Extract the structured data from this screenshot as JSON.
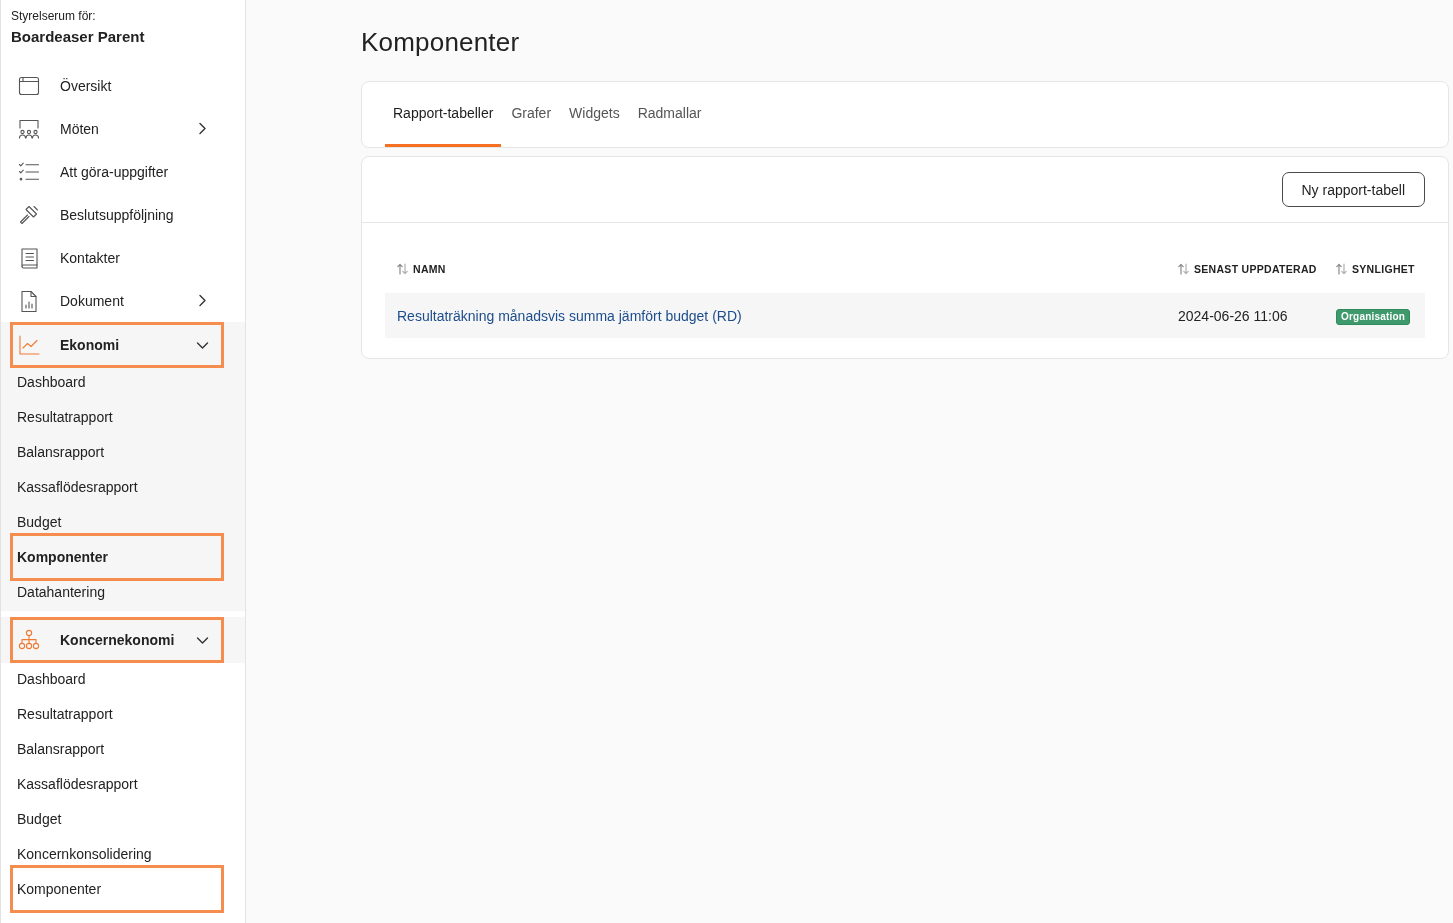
{
  "sidebar": {
    "caption": "Styrelserum för:",
    "org_name": "Boardeaser Parent",
    "items": [
      {
        "kind": "link",
        "label": "Översikt",
        "highlighted": false
      },
      {
        "kind": "group",
        "label": "Möten",
        "expanded": false,
        "highlighted": false
      },
      {
        "kind": "link",
        "label": "Att göra-uppgifter",
        "highlighted": false
      },
      {
        "kind": "link",
        "label": "Beslutsuppföljning",
        "highlighted": false
      },
      {
        "kind": "link",
        "label": "Kontakter",
        "highlighted": false
      },
      {
        "kind": "group",
        "label": "Dokument",
        "expanded": false,
        "highlighted": false
      },
      {
        "kind": "group",
        "label": "Ekonomi",
        "expanded": true,
        "highlighted": true,
        "children": [
          {
            "label": "Dashboard",
            "selected": false,
            "highlighted": false
          },
          {
            "label": "Resultatrapport",
            "selected": false,
            "highlighted": false
          },
          {
            "label": "Balansrapport",
            "selected": false,
            "highlighted": false
          },
          {
            "label": "Kassaflödesrapport",
            "selected": false,
            "highlighted": false
          },
          {
            "label": "Budget",
            "selected": false,
            "highlighted": false
          },
          {
            "label": "Komponenter",
            "selected": true,
            "highlighted": true
          },
          {
            "label": "Datahantering",
            "selected": false,
            "highlighted": false
          }
        ]
      },
      {
        "kind": "group",
        "label": "Koncernekonomi",
        "expanded": true,
        "highlighted": true,
        "children": [
          {
            "label": "Dashboard",
            "selected": false,
            "highlighted": false
          },
          {
            "label": "Resultatrapport",
            "selected": false,
            "highlighted": false
          },
          {
            "label": "Balansrapport",
            "selected": false,
            "highlighted": false
          },
          {
            "label": "Kassaflödesrapport",
            "selected": false,
            "highlighted": false
          },
          {
            "label": "Budget",
            "selected": false,
            "highlighted": false
          },
          {
            "label": "Koncernkonsolidering",
            "selected": false,
            "highlighted": false
          },
          {
            "label": "Komponenter",
            "selected": false,
            "highlighted": true
          }
        ]
      }
    ]
  },
  "main": {
    "title": "Komponenter",
    "tabs": [
      {
        "label": "Rapport-tabeller",
        "selected": true
      },
      {
        "label": "Grafer",
        "selected": false
      },
      {
        "label": "Widgets",
        "selected": false
      },
      {
        "label": "Radmallar",
        "selected": false
      }
    ],
    "button": "Ny rapport-tabell",
    "table": {
      "columns": [
        {
          "label": "NAMN"
        },
        {
          "label": "SENAST UPPDATERAD"
        },
        {
          "label": "SYNLIGHET"
        }
      ],
      "rows": [
        {
          "name": "Resultaträkning månadsvis summa jämfört budget (RD)",
          "updated": "2024-06-26 11:06",
          "visibility": "Organisation"
        }
      ]
    }
  }
}
